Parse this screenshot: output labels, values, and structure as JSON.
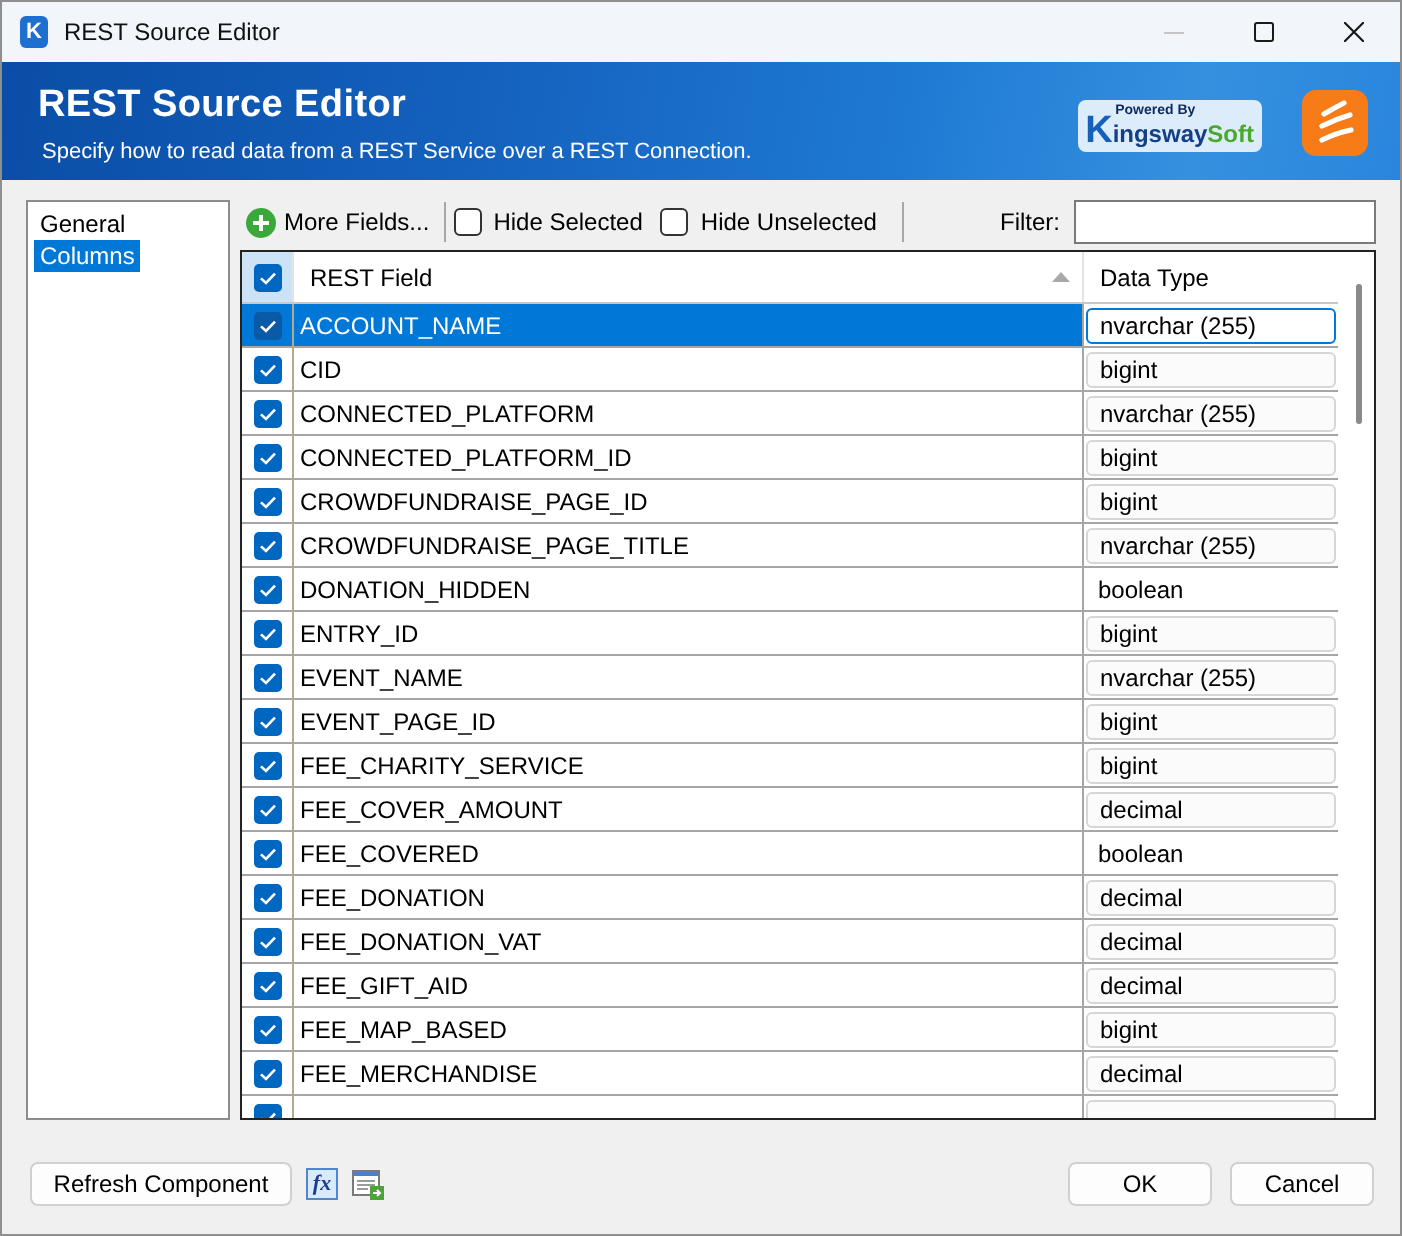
{
  "window": {
    "icon_letter": "K",
    "title": "REST Source Editor",
    "minimize": {
      "disabled": true
    }
  },
  "header": {
    "title": "REST Source Editor",
    "subtitle": "Specify how to read data from a REST Service over a REST Connection.",
    "brand": {
      "tagline": "Powered By",
      "initial": "K",
      "name": "ingsway",
      "suffix": "Soft"
    }
  },
  "nav": {
    "items": [
      {
        "label": "General",
        "selected": false
      },
      {
        "label": "Columns",
        "selected": true
      }
    ]
  },
  "toolbar": {
    "more_fields": "More Fields...",
    "options": [
      {
        "label": "Hide Selected",
        "checked": false
      },
      {
        "label": "Hide Unselected",
        "checked": false
      }
    ],
    "filter": {
      "label": "Filter:"
    }
  },
  "table": {
    "select_all": {
      "checked": true
    },
    "columns": [
      {
        "label": "REST Field",
        "sorted": true
      },
      {
        "label": "Data Type"
      }
    ],
    "rows": [
      {
        "field": "ACCOUNT_NAME",
        "data_type": "nvarchar (255)",
        "kind": "dropdown",
        "checked": true,
        "selected": true
      },
      {
        "field": "CID",
        "data_type": "bigint",
        "kind": "dropdown",
        "checked": true,
        "selected": false
      },
      {
        "field": "CONNECTED_PLATFORM",
        "data_type": "nvarchar (255)",
        "kind": "dropdown",
        "checked": true,
        "selected": false
      },
      {
        "field": "CONNECTED_PLATFORM_ID",
        "data_type": "bigint",
        "kind": "dropdown",
        "checked": true,
        "selected": false
      },
      {
        "field": "CROWDFUNDRAISE_PAGE_ID",
        "data_type": "bigint",
        "kind": "dropdown",
        "checked": true,
        "selected": false
      },
      {
        "field": "CROWDFUNDRAISE_PAGE_TITLE",
        "data_type": "nvarchar (255)",
        "kind": "dropdown",
        "checked": true,
        "selected": false
      },
      {
        "field": "DONATION_HIDDEN",
        "data_type": "boolean",
        "kind": "text",
        "checked": true,
        "selected": false
      },
      {
        "field": "ENTRY_ID",
        "data_type": "bigint",
        "kind": "dropdown",
        "checked": true,
        "selected": false
      },
      {
        "field": "EVENT_NAME",
        "data_type": "nvarchar (255)",
        "kind": "dropdown",
        "checked": true,
        "selected": false
      },
      {
        "field": "EVENT_PAGE_ID",
        "data_type": "bigint",
        "kind": "dropdown",
        "checked": true,
        "selected": false
      },
      {
        "field": "FEE_CHARITY_SERVICE",
        "data_type": "bigint",
        "kind": "dropdown",
        "checked": true,
        "selected": false
      },
      {
        "field": "FEE_COVER_AMOUNT",
        "data_type": "decimal",
        "kind": "dropdown",
        "checked": true,
        "selected": false
      },
      {
        "field": "FEE_COVERED",
        "data_type": "boolean",
        "kind": "text",
        "checked": true,
        "selected": false
      },
      {
        "field": "FEE_DONATION",
        "data_type": "decimal",
        "kind": "dropdown",
        "checked": true,
        "selected": false
      },
      {
        "field": "FEE_DONATION_VAT",
        "data_type": "decimal",
        "kind": "dropdown",
        "checked": true,
        "selected": false
      },
      {
        "field": "FEE_GIFT_AID",
        "data_type": "decimal",
        "kind": "dropdown",
        "checked": true,
        "selected": false
      },
      {
        "field": "FEE_MAP_BASED",
        "data_type": "bigint",
        "kind": "dropdown",
        "checked": true,
        "selected": false
      },
      {
        "field": "FEE_MERCHANDISE",
        "data_type": "decimal",
        "kind": "dropdown",
        "checked": true,
        "selected": false
      },
      {
        "kind": "dropdown",
        "checked": true,
        "selected": false
      }
    ]
  },
  "footer": {
    "refresh": "Refresh Component",
    "expression": "fx",
    "buttons": [
      "OK",
      "Cancel"
    ]
  }
}
